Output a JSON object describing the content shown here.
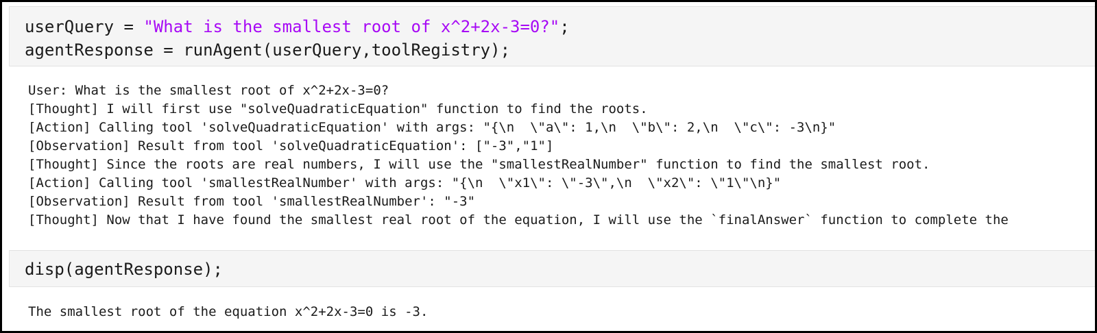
{
  "cell1": {
    "line1_prefix": "userQuery = ",
    "line1_string": "\"What is the smallest root of x^2+2x-3=0?\"",
    "line1_suffix": ";",
    "line2": "agentResponse = runAgent(userQuery,toolRegistry);"
  },
  "output1": {
    "lines": [
      "User: What is the smallest root of x^2+2x-3=0?",
      "[Thought] I will first use \"solveQuadraticEquation\" function to find the roots.",
      "[Action] Calling tool 'solveQuadraticEquation' with args: \"{\\n  \\\"a\\\": 1,\\n  \\\"b\\\": 2,\\n  \\\"c\\\": -3\\n}\"",
      "[Observation] Result from tool 'solveQuadraticEquation': [\"-3\",\"1\"]",
      "[Thought] Since the roots are real numbers, I will use the \"smallestRealNumber\" function to find the smallest root.",
      "[Action] Calling tool 'smallestRealNumber' with args: \"{\\n  \\\"x1\\\": \\\"-3\\\",\\n  \\\"x2\\\": \\\"1\\\"\\n}\"",
      "[Observation] Result from tool 'smallestRealNumber': \"-3\"",
      "[Thought] Now that I have found the smallest real root of the equation, I will use the `finalAnswer` function to complete the"
    ]
  },
  "cell2": {
    "line1": "disp(agentResponse);"
  },
  "output2": {
    "line1": "The smallest root of the equation x^2+2x-3=0 is -3."
  },
  "colors": {
    "string": "#a709f5",
    "cell_background": "#f5f5f5",
    "text": "#1a1a1a"
  }
}
